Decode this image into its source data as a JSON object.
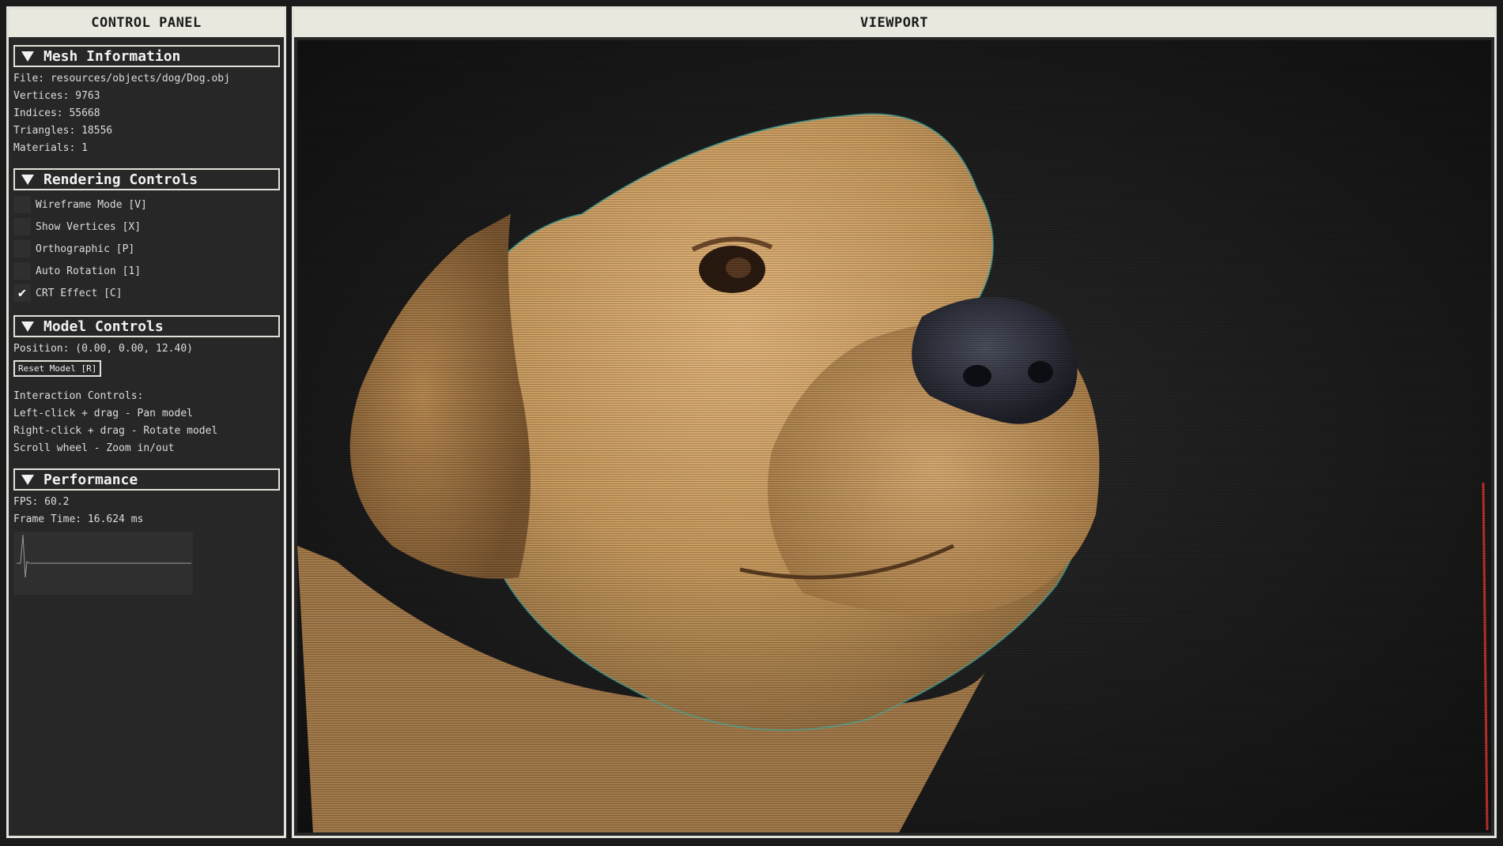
{
  "control_panel": {
    "title": "CONTROL PANEL",
    "mesh": {
      "title": "Mesh Information",
      "file": "File: resources/objects/dog/Dog.obj",
      "vertices": "Vertices: 9763",
      "indices": "Indices: 55668",
      "triangles": "Triangles: 18556",
      "materials": "Materials: 1"
    },
    "rendering": {
      "title": "Rendering Controls",
      "options": [
        {
          "label": "Wireframe Mode [V]",
          "checked": false
        },
        {
          "label": "Show Vertices [X]",
          "checked": false
        },
        {
          "label": "Orthographic [P]",
          "checked": false
        },
        {
          "label": "Auto Rotation [1]",
          "checked": false
        },
        {
          "label": "CRT Effect [C]",
          "checked": true
        }
      ]
    },
    "model": {
      "title": "Model Controls",
      "position": "Position: (0.00, 0.00, 12.40)",
      "reset_label": "Reset Model [R]",
      "interaction_title": "Interaction Controls:",
      "interaction_lines": [
        "Left-click + drag - Pan model",
        "Right-click + drag - Rotate model",
        "Scroll wheel - Zoom in/out"
      ]
    },
    "performance": {
      "title": "Performance",
      "fps": "FPS: 60.2",
      "frame_time": "Frame Time: 16.624 ms"
    }
  },
  "viewport": {
    "title": "VIEWPORT"
  },
  "colors": {
    "panel_bg": "#272727",
    "header_bg": "#e8e8de",
    "border": "#e2e2da",
    "text": "#dcdcdc",
    "dog_fur": "#c89a5e",
    "dog_nose": "#2a2c36"
  },
  "icons": {
    "collapse": "triangle-down-icon",
    "check": "checkmark-icon"
  }
}
